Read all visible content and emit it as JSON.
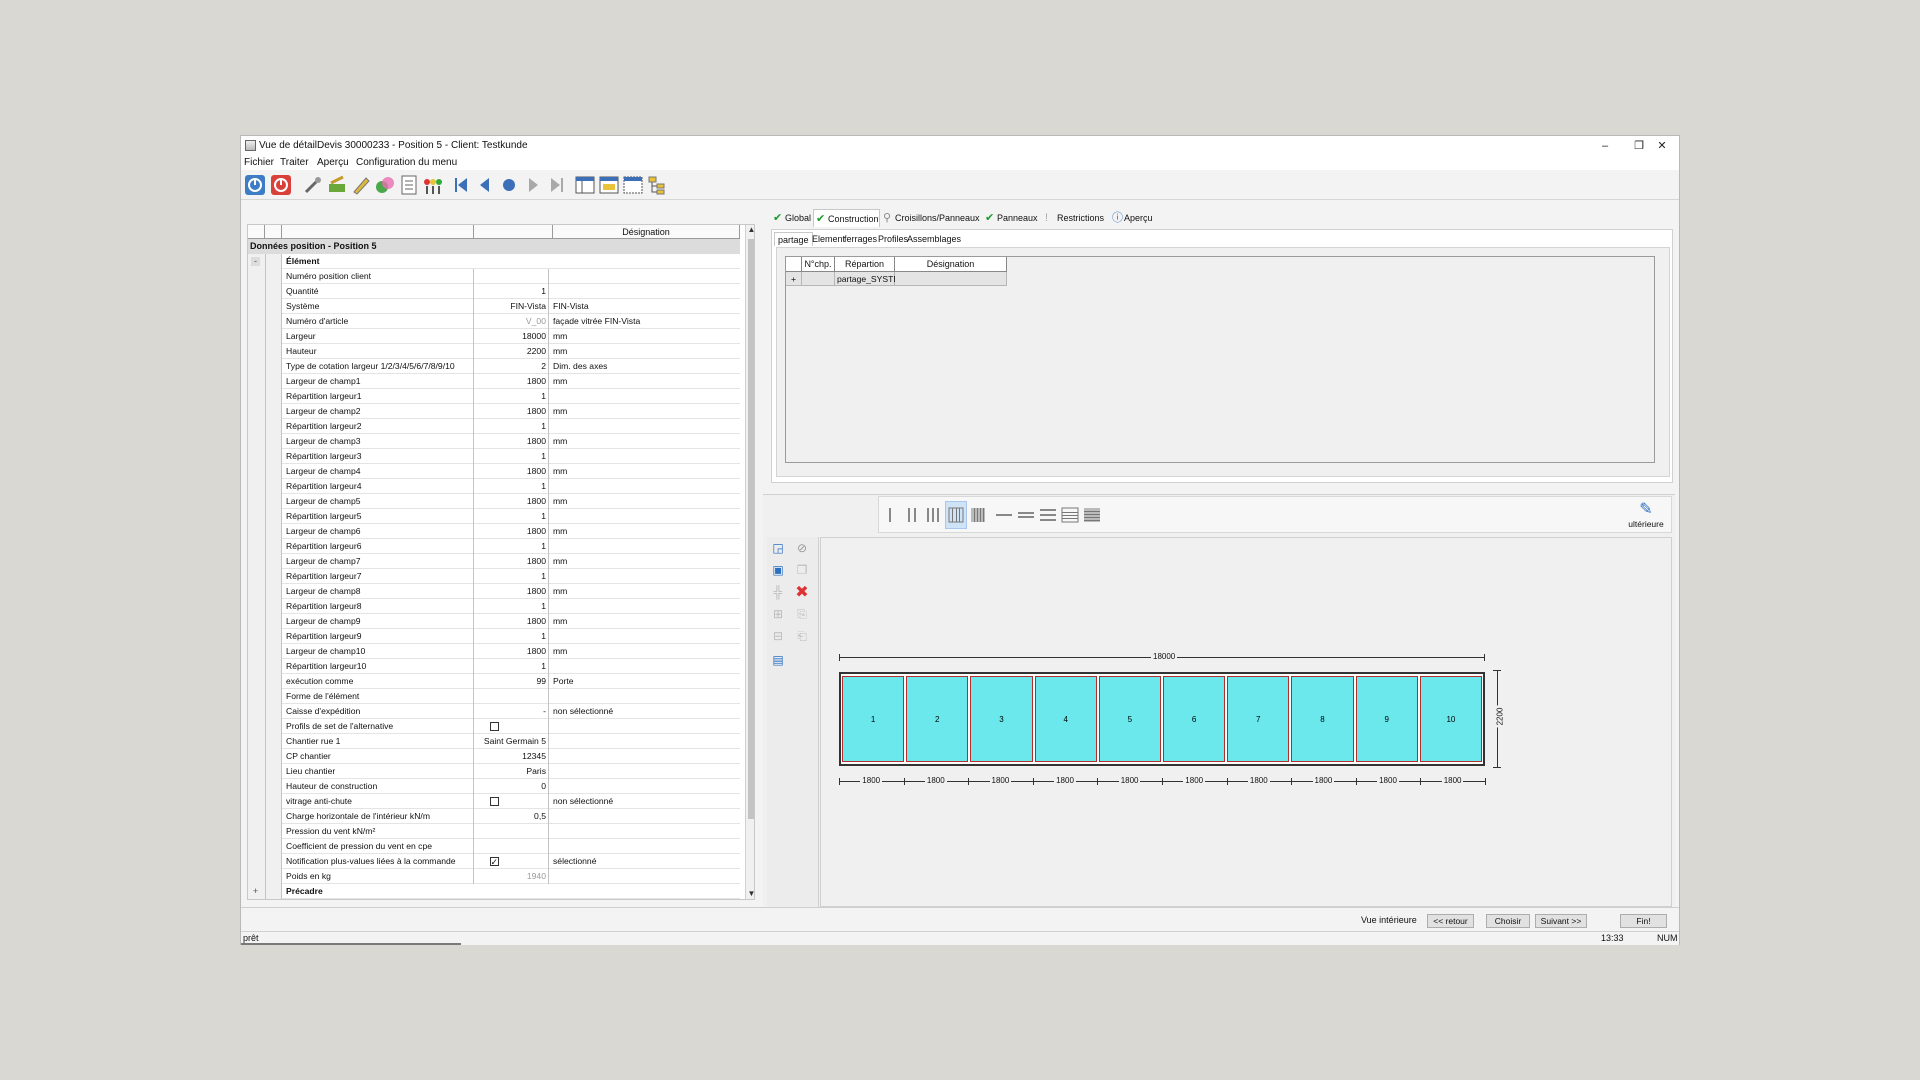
{
  "window": {
    "title": "Vue de détailDevis 30000233 - Position 5 - Client: Testkunde"
  },
  "menu": [
    "Fichier",
    "Traiter",
    "Aperçu",
    "Configuration du menu"
  ],
  "left_grid": {
    "header_designation": "Désignation",
    "section_title": "Données position - Position 5",
    "group_element": "Élément",
    "group_precadre": "Précadre",
    "rows": [
      {
        "label": "Numéro position client",
        "value": "",
        "des": ""
      },
      {
        "label": "Quantité",
        "value": "1",
        "des": ""
      },
      {
        "label": "Système",
        "value": "FIN-Vista",
        "des": "FIN-Vista"
      },
      {
        "label": "Numéro d'article",
        "value": "V_00",
        "des": "façade vitrée FIN-Vista",
        "grey": true
      },
      {
        "label": "Largeur",
        "value": "18000",
        "des": "mm"
      },
      {
        "label": "Hauteur",
        "value": "2200",
        "des": "mm"
      },
      {
        "label": "Type de cotation largeur 1/2/3/4/5/6/7/8/9/10",
        "value": "2",
        "des": "Dim. des axes"
      },
      {
        "label": "Largeur de champ1",
        "value": "1800",
        "des": "mm"
      },
      {
        "label": "Répartition largeur1",
        "value": "1",
        "des": ""
      },
      {
        "label": "Largeur de champ2",
        "value": "1800",
        "des": "mm"
      },
      {
        "label": "Répartition largeur2",
        "value": "1",
        "des": ""
      },
      {
        "label": "Largeur de champ3",
        "value": "1800",
        "des": "mm"
      },
      {
        "label": "Répartition largeur3",
        "value": "1",
        "des": ""
      },
      {
        "label": "Largeur de champ4",
        "value": "1800",
        "des": "mm"
      },
      {
        "label": "Répartition largeur4",
        "value": "1",
        "des": ""
      },
      {
        "label": "Largeur de champ5",
        "value": "1800",
        "des": "mm"
      },
      {
        "label": "Répartition largeur5",
        "value": "1",
        "des": ""
      },
      {
        "label": "Largeur de champ6",
        "value": "1800",
        "des": "mm"
      },
      {
        "label": "Répartition largeur6",
        "value": "1",
        "des": ""
      },
      {
        "label": "Largeur de champ7",
        "value": "1800",
        "des": "mm"
      },
      {
        "label": "Répartition largeur7",
        "value": "1",
        "des": ""
      },
      {
        "label": "Largeur de champ8",
        "value": "1800",
        "des": "mm"
      },
      {
        "label": "Répartition largeur8",
        "value": "1",
        "des": ""
      },
      {
        "label": "Largeur de champ9",
        "value": "1800",
        "des": "mm"
      },
      {
        "label": "Répartition largeur9",
        "value": "1",
        "des": ""
      },
      {
        "label": "Largeur de champ10",
        "value": "1800",
        "des": "mm"
      },
      {
        "label": "Répartition largeur10",
        "value": "1",
        "des": ""
      },
      {
        "label": "exécution comme",
        "value": "99",
        "des": "Porte"
      },
      {
        "label": "Forme de l'élément",
        "value": "",
        "des": ""
      },
      {
        "label": "Caisse d'expédition",
        "value": "-",
        "des": "non sélectionné"
      },
      {
        "label": "Profils de set de l'alternative",
        "value": "",
        "des": "",
        "checkbox": "off"
      },
      {
        "label": "Chantier rue 1",
        "value": "Saint Germain 5",
        "des": ""
      },
      {
        "label": "CP chantier",
        "value": "12345",
        "des": ""
      },
      {
        "label": "Lieu chantier",
        "value": "Paris",
        "des": ""
      },
      {
        "label": "Hauteur de construction",
        "value": "0",
        "des": ""
      },
      {
        "label": "vitrage anti-chute",
        "value": "",
        "des": "non sélectionné",
        "checkbox": "off"
      },
      {
        "label": "Charge horizontale de l'intérieur kN/m",
        "value": "0,5",
        "des": ""
      },
      {
        "label": "Pression du vent kN/m²",
        "value": "",
        "des": ""
      },
      {
        "label": "Coefficient de pression du vent en cpe",
        "value": "",
        "des": ""
      },
      {
        "label": "Notification plus-values liées à la commande",
        "value": "",
        "des": "sélectionné",
        "checkbox": "on"
      },
      {
        "label": "Poids en kg",
        "value": "1940",
        "des": "",
        "grey": true
      }
    ]
  },
  "main_tabs": [
    "Global",
    "Construction",
    "Croisillons/Panneaux",
    "Panneaux",
    "Restrictions",
    "Aperçu"
  ],
  "sub_tabs": [
    "partage",
    "Element",
    "ferrages",
    "Profiles",
    "Assemblages"
  ],
  "inner_grid": {
    "headers": [
      "N°chp.",
      "Répartion",
      "Désignation"
    ],
    "row": {
      "expand": "+",
      "rep": "partage_SYSTE"
    }
  },
  "lower": {
    "ulterieure_label": "ultérieure",
    "total_width": "18000",
    "height_dim": "2200",
    "panels": [
      "1",
      "2",
      "3",
      "4",
      "5",
      "6",
      "7",
      "8",
      "9",
      "10"
    ],
    "field_widths": [
      "1800",
      "1800",
      "1800",
      "1800",
      "1800",
      "1800",
      "1800",
      "1800",
      "1800",
      "1800"
    ]
  },
  "buttons": {
    "view": "Vue intérieure",
    "back": "<< retour",
    "choose": "Choisir",
    "next": "Suivant >>",
    "finish": "Fin!"
  },
  "status": {
    "text": "prêt",
    "time": "13:33",
    "num": "NUM"
  },
  "colors": {
    "panel": "#6ae8ec",
    "panel_border": "#b03030",
    "ok_green": "#1a9a2a",
    "info_blue": "#2a6fc4"
  }
}
